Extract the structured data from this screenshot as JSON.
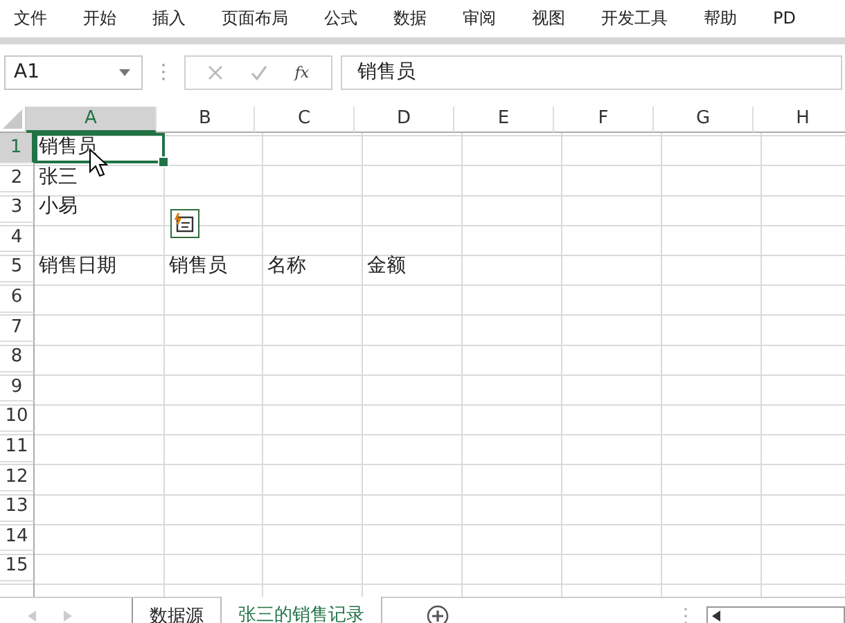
{
  "menu": [
    "文件",
    "开始",
    "插入",
    "页面布局",
    "公式",
    "数据",
    "审阅",
    "视图",
    "开发工具",
    "帮助",
    "PD"
  ],
  "formula_bar": {
    "name_box": "A1",
    "function_label": "fx",
    "formula": "销售员"
  },
  "columns": [
    {
      "label": "A",
      "selected": true
    },
    {
      "label": "B",
      "selected": false
    },
    {
      "label": "C",
      "selected": false
    },
    {
      "label": "D",
      "selected": false
    },
    {
      "label": "E",
      "selected": false
    },
    {
      "label": "F",
      "selected": false
    },
    {
      "label": "G",
      "selected": false
    },
    {
      "label": "H",
      "selected": false
    }
  ],
  "rows": [
    {
      "label": "1",
      "selected": true,
      "cells": [
        {
          "text": "销售员",
          "selected": true
        }
      ]
    },
    {
      "label": "2",
      "selected": false,
      "cells": [
        {
          "text": "张三",
          "selected": false
        }
      ]
    },
    {
      "label": "3",
      "selected": false,
      "cells": [
        {
          "text": "小易",
          "selected": false
        }
      ]
    },
    {
      "label": "4",
      "selected": false
    },
    {
      "label": "5",
      "selected": false,
      "cells": [
        {
          "text": "销售日期",
          "selected": false
        },
        {
          "text": "销售员",
          "selected": false
        },
        {
          "text": "名称",
          "selected": false
        },
        {
          "text": "金额",
          "selected": false
        }
      ]
    },
    {
      "label": "6",
      "selected": false
    },
    {
      "label": "7",
      "selected": false
    },
    {
      "label": "8",
      "selected": false
    },
    {
      "label": "9",
      "selected": false
    },
    {
      "label": "10",
      "selected": false
    },
    {
      "label": "11",
      "selected": false
    },
    {
      "label": "12",
      "selected": false
    },
    {
      "label": "13",
      "selected": false
    },
    {
      "label": "14",
      "selected": false
    },
    {
      "label": "15",
      "selected": false
    }
  ],
  "sheet_tabs": [
    {
      "label": "数据源",
      "selected": false
    },
    {
      "label": "张三的销售记录",
      "selected": true
    }
  ]
}
